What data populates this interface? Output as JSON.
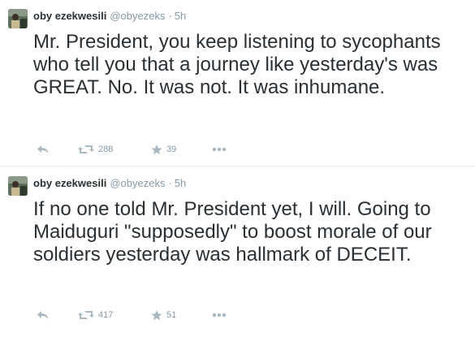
{
  "tweets": [
    {
      "fullname": "oby ezekwesili",
      "username": "@obyezeks",
      "separator": "·",
      "time": "5h",
      "text": "Mr. President, you keep listening to sycophants who tell you that a journey like yesterday's was GREAT. No. It was not. It was inhumane.",
      "retweets": "288",
      "favorites": "39",
      "icons": [
        "reply-icon",
        "retweet-icon",
        "favorite-star-icon",
        "more-dots-icon"
      ]
    },
    {
      "fullname": "oby ezekwesili",
      "username": "@obyezeks",
      "separator": "·",
      "time": "5h",
      "text": "If no one told Mr. President yet, I will. Going to Maiduguri \"supposedly\" to boost morale of our soldiers yesterday was hallmark of DECEIT.",
      "retweets": "417",
      "favorites": "51",
      "icons": [
        "reply-icon",
        "retweet-icon",
        "favorite-star-icon",
        "more-dots-icon"
      ]
    }
  ],
  "colors": {
    "text": "#292f33",
    "meta": "#8899a6",
    "icon": "#aab8c2",
    "divider": "#e1e8ed"
  }
}
